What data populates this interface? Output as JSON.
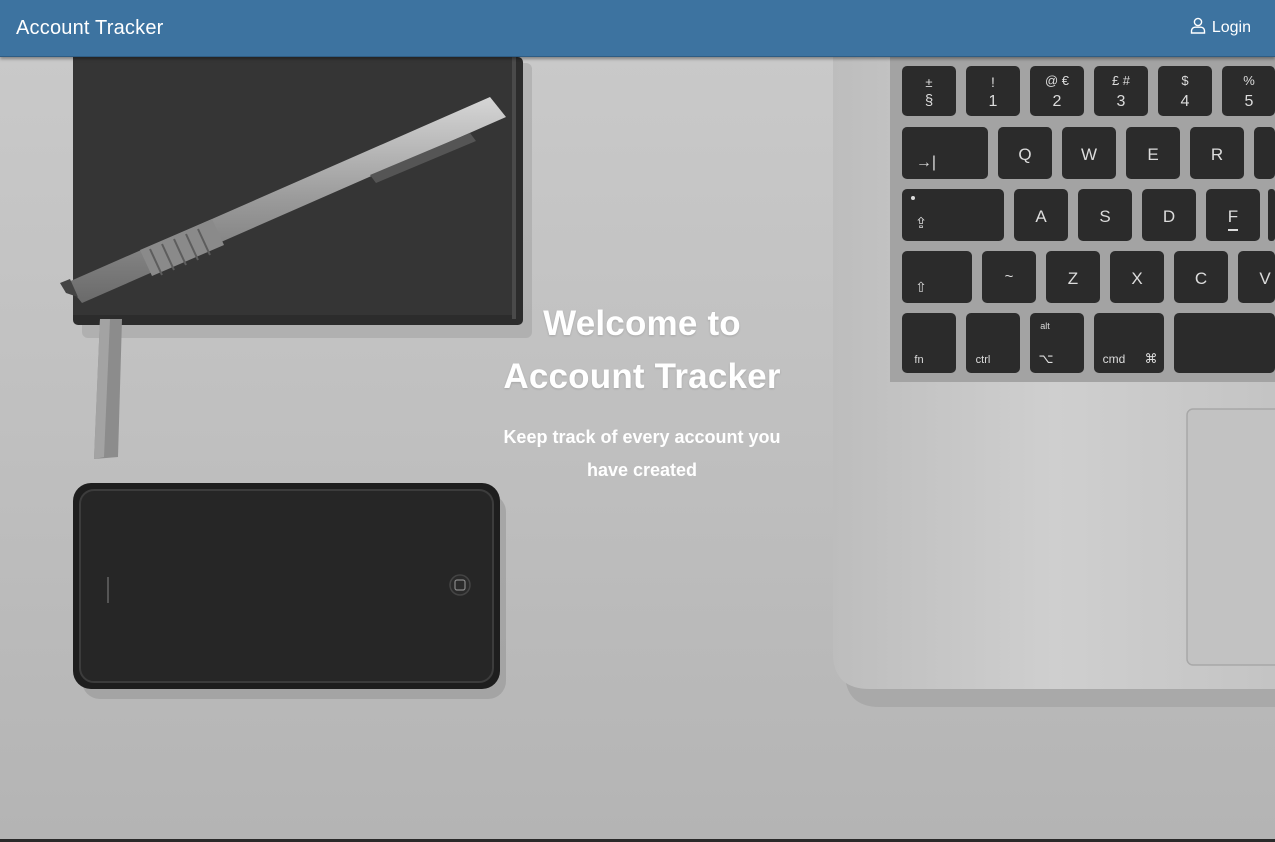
{
  "navbar": {
    "brand": "Account Tracker",
    "login_label": "Login",
    "login_icon": "user-icon",
    "background": "#3d73a0"
  },
  "hero": {
    "title_line1": "Welcome to",
    "title_line2": "Account Tracker",
    "subtitle": "Keep track of every account you have created"
  },
  "keyboard": {
    "row1": [
      [
        "±",
        "§"
      ],
      [
        "!",
        "1"
      ],
      [
        "@ €",
        "2"
      ],
      [
        "£ #",
        "3"
      ],
      [
        "$",
        "4"
      ],
      [
        "%",
        "5"
      ]
    ],
    "row2": [
      "→|",
      "Q",
      "W",
      "E",
      "R"
    ],
    "row3": [
      "⇪",
      "A",
      "S",
      "D",
      "F"
    ],
    "row4": [
      "⇧",
      "~",
      "Z",
      "X",
      "C",
      "V"
    ],
    "row5": [
      "fn",
      "ctrl",
      "alt",
      "⌥",
      "cmd",
      "⌘"
    ]
  }
}
